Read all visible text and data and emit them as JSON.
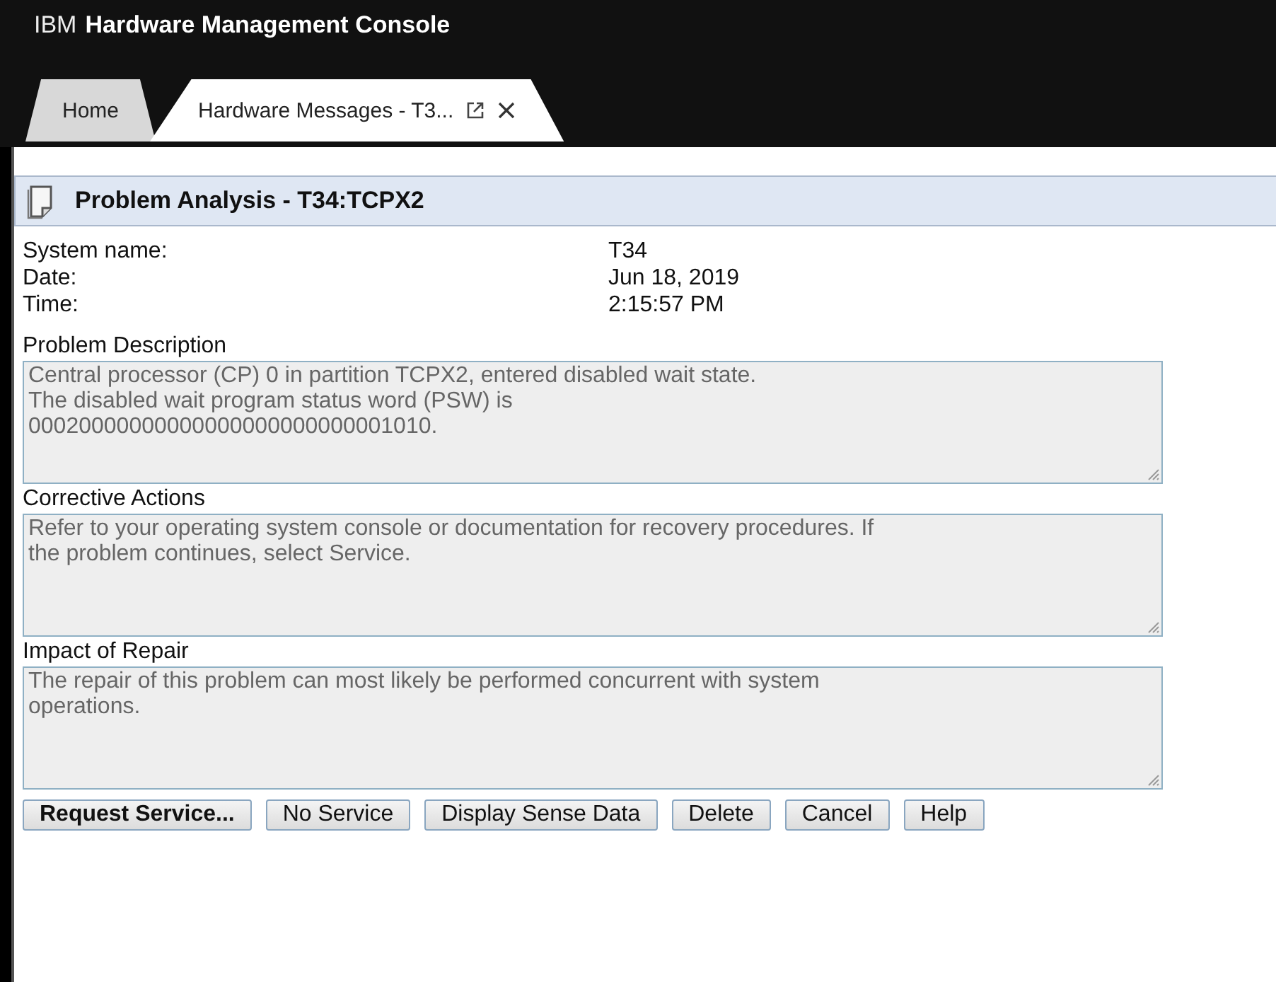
{
  "app_title": {
    "brand": "IBM",
    "name": "Hardware Management Console"
  },
  "tabs": [
    {
      "label": "Home",
      "selected": false,
      "closable": false
    },
    {
      "label": "Hardware Messages - T3...",
      "selected": true,
      "closable": true
    }
  ],
  "panel": {
    "title": "Problem Analysis - T34:TCPX2"
  },
  "details": [
    {
      "label": "System name:",
      "value": "T34"
    },
    {
      "label": "Date:",
      "value": "Jun 18, 2019"
    },
    {
      "label": "Time:",
      "value": "2:15:57 PM"
    }
  ],
  "sections": [
    {
      "heading": "Problem Description",
      "lines": [
        "Central processor (CP) 0 in partition TCPX2, entered disabled wait state.",
        "The disabled wait program status word (PSW) is",
        "00020000000000000000000000001010."
      ]
    },
    {
      "heading": "Corrective Actions",
      "lines": [
        "Refer to your operating system console or documentation for recovery procedures. If",
        "the problem continues, select Service."
      ]
    },
    {
      "heading": "Impact of Repair",
      "lines": [
        "The repair of this problem can most likely be performed concurrent with system",
        "operations."
      ]
    }
  ],
  "buttons": [
    {
      "label": "Request Service...",
      "default": true
    },
    {
      "label": "No Service",
      "default": false
    },
    {
      "label": "Display Sense Data",
      "default": false
    },
    {
      "label": "Delete",
      "default": false
    },
    {
      "label": "Cancel",
      "default": false
    },
    {
      "label": "Help",
      "default": false
    }
  ]
}
